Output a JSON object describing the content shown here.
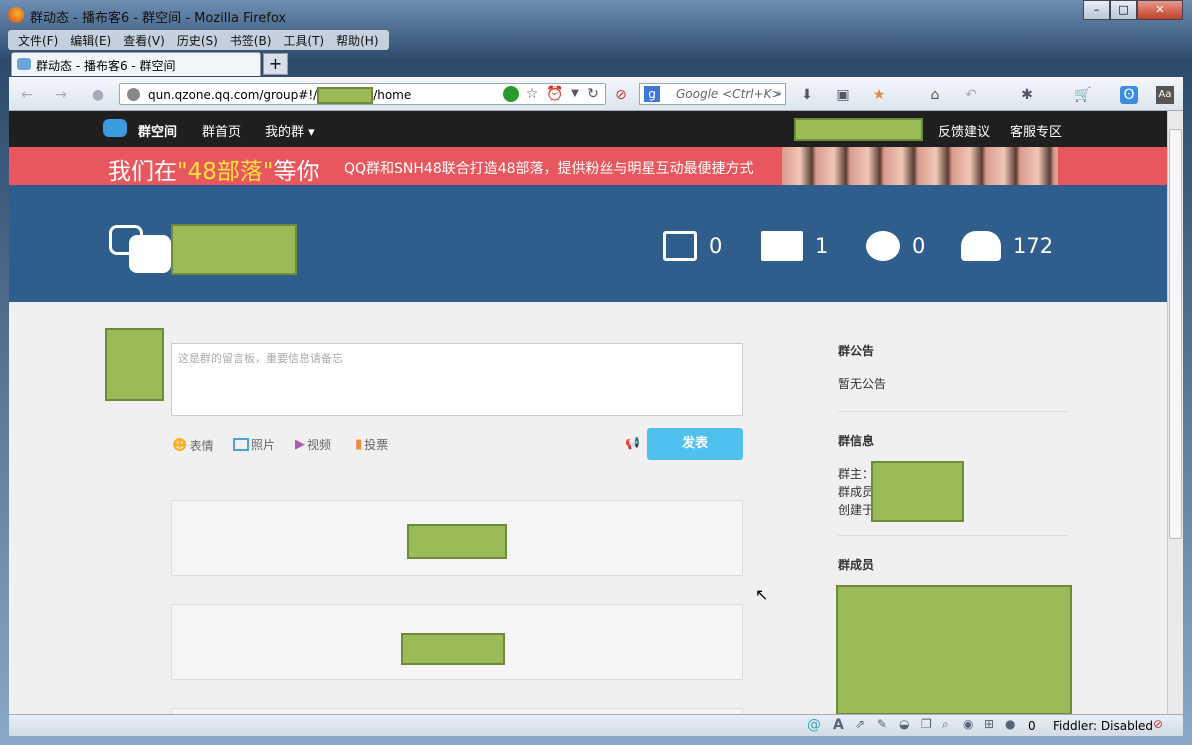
{
  "window": {
    "title": "群动态 - 播布客6 - 群空间 - Mozilla Firefox"
  },
  "menu": [
    "文件(F)",
    "编辑(E)",
    "查看(V)",
    "历史(S)",
    "书签(B)",
    "工具(T)",
    "帮助(H)"
  ],
  "tab": {
    "label": "群动态 - 播布客6 - 群空间",
    "new_tab": "+"
  },
  "urlbar": {
    "prefix": "qun.qzone.qq.com/group#!/",
    "suffix": "/home"
  },
  "search": {
    "placeholder": "Google <Ctrl+K>"
  },
  "site": {
    "logo": "群空间",
    "nav": [
      "群首页",
      "我的群 ▾"
    ],
    "right_links": [
      "反馈建议",
      "客服专区"
    ],
    "banner": {
      "pre": "我们在",
      "highlight": "\"48部落\"",
      "post": "等你",
      "sub": "QQ群和SNH48联合打造48部落，提供粉丝与明星互动最便捷方式"
    },
    "stats": [
      {
        "icon": "photo-icon",
        "value": "0"
      },
      {
        "icon": "folder-icon",
        "value": "1"
      },
      {
        "icon": "comment-icon",
        "value": "0"
      },
      {
        "icon": "members-icon",
        "value": "172"
      }
    ],
    "composer": {
      "placeholder": "这是群的留言板，重要信息请备忘",
      "tools": [
        "表情",
        "照片",
        "视频",
        "投票"
      ],
      "submit": "发表"
    },
    "sidebar": {
      "notice_title": "群公告",
      "notice_text": "暂无公告",
      "info_title": "群信息",
      "info_lines": [
        "群主：",
        "群成员",
        "创建于"
      ],
      "members_title": "群成员"
    }
  },
  "status": {
    "count": "0",
    "fiddler": "Fiddler: Disabled"
  }
}
